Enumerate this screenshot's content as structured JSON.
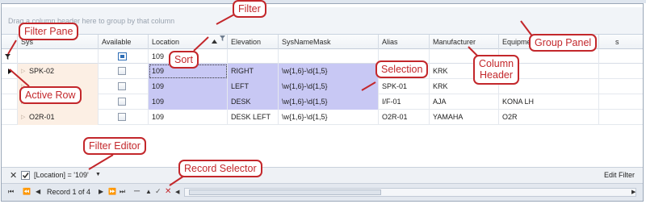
{
  "group_panel": {
    "hint": "Drag a column header here to group by that column"
  },
  "columns": {
    "sys": "Sys",
    "available": "Available",
    "location": "Location",
    "elevation": "Elevation",
    "sysnamemask": "SysNameMask",
    "alias": "Alias",
    "manufacturer": "Manufacturer",
    "equipment": "Equipme",
    "extra": "s"
  },
  "filter_row": {
    "location_value": "109"
  },
  "rows": [
    {
      "sys": "SPK-02",
      "location": "109",
      "elevation": "RIGHT",
      "mask": "\\w{1,6}-\\d{1,5}",
      "alias": "",
      "manufacturer": "KRK",
      "equipment": ""
    },
    {
      "sys": "",
      "location": "109",
      "elevation": "LEFT",
      "mask": "\\w{1,6}-\\d{1,5}",
      "alias": "SPK-01",
      "manufacturer": "KRK",
      "equipment": ""
    },
    {
      "sys": "",
      "location": "109",
      "elevation": "DESK",
      "mask": "\\w{1,6}-\\d{1,5}",
      "alias": "I/F-01",
      "manufacturer": "AJA",
      "equipment": "KONA LH"
    },
    {
      "sys": "O2R-01",
      "location": "109",
      "elevation": "DESK LEFT",
      "mask": "\\w{1,6}-\\d{1,5}",
      "alias": "O2R-01",
      "manufacturer": "YAMAHA",
      "equipment": "O2R"
    }
  ],
  "filter_bar": {
    "expression": "[Location] = '109'",
    "edit_label": "Edit Filter"
  },
  "navigator": {
    "record_text": "Record 1 of 4"
  },
  "callouts": {
    "filter": "Filter",
    "filter_pane": "Filter Pane",
    "sort": "Sort",
    "selection": "Selection",
    "group_panel": "Group Panel",
    "column_header_1": "Column",
    "column_header_2": "Header",
    "active_row": "Active Row",
    "filter_editor": "Filter Editor",
    "record_selector": "Record Selector"
  },
  "colors": {
    "callout_red": "#c3272b",
    "selection": "#c8c8f4",
    "sys_column": "#fcefe4",
    "link_blue": "#2d6db5"
  },
  "icons": [
    "filter-funnel-icon",
    "sort-ascending-icon",
    "active-row-arrow-icon",
    "expand-icon",
    "close-icon",
    "checkbox-icon",
    "dropdown-icon",
    "nav-first-icon",
    "nav-prev-page-icon",
    "nav-prev-icon",
    "nav-next-icon",
    "nav-next-page-icon",
    "nav-last-icon",
    "nav-append-icon",
    "nav-delete-icon",
    "nav-edit-icon",
    "nav-save-icon",
    "nav-cancel-icon"
  ]
}
